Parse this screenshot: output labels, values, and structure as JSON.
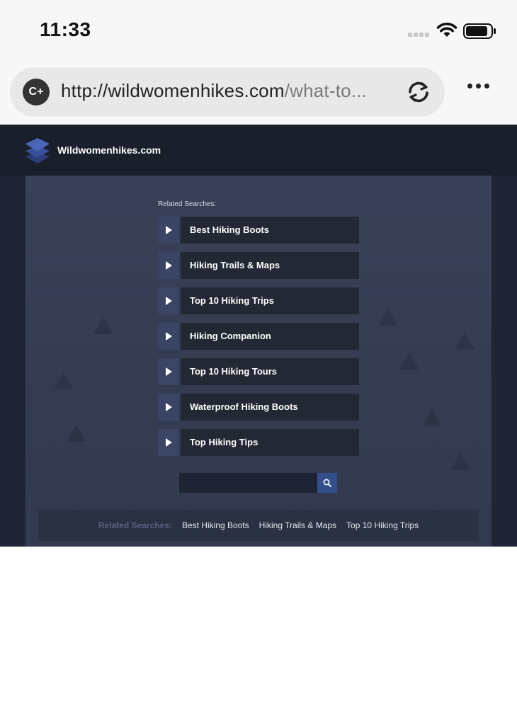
{
  "status_bar": {
    "time": "11:33"
  },
  "browser": {
    "site_badge": "C+",
    "url_domain": "http://wildwomenhikes.com",
    "url_path": "/what-to..."
  },
  "site": {
    "title": "Wildwomenhikes.com"
  },
  "related_searches": {
    "heading": "Related Searches:",
    "items": [
      "Best Hiking Boots",
      "Hiking Trails & Maps",
      "Top 10 Hiking Trips",
      "Hiking Companion",
      "Top 10 Hiking Tours",
      "Waterproof Hiking Boots",
      "Top Hiking Tips"
    ]
  },
  "search": {
    "value": "",
    "placeholder": ""
  },
  "footer": {
    "title": "Related Searches:",
    "links": [
      "Best Hiking Boots",
      "Hiking Trails & Maps",
      "Top 10 Hiking Trips"
    ]
  },
  "colors": {
    "page_bg": "#1f2534",
    "panel_bg": "#394158",
    "item_bg": "#232835",
    "arrow_bg": "#3a4565",
    "search_button": "#33508b"
  }
}
